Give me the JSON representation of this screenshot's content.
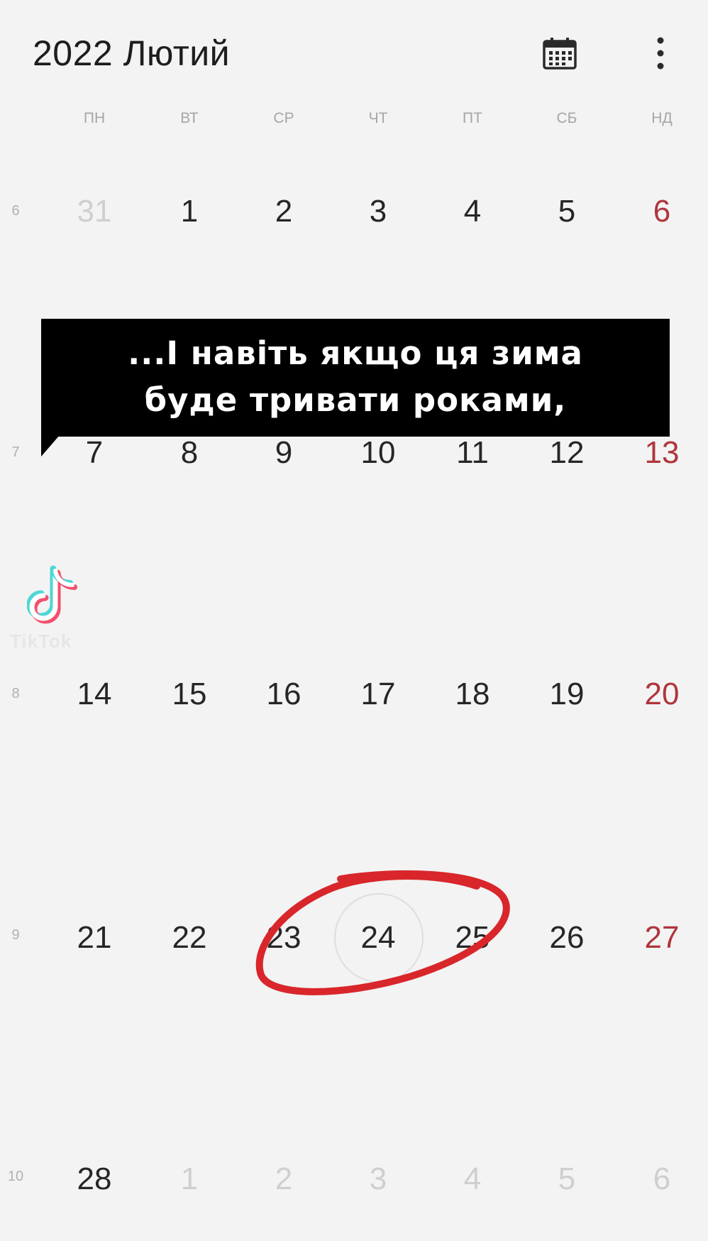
{
  "header": {
    "title": "2022 Лютий",
    "calendar_icon": "calendar-grid-icon",
    "more_icon": "more-vertical-icon"
  },
  "weekdays": [
    "ПН",
    "ВТ",
    "СР",
    "ЧТ",
    "ПТ",
    "СБ",
    "НД"
  ],
  "weeks": [
    {
      "num": "6",
      "days": [
        "31",
        "1",
        "2",
        "3",
        "4",
        "5",
        "6"
      ]
    },
    {
      "num": "7",
      "days": [
        "7",
        "8",
        "9",
        "10",
        "11",
        "12",
        "13"
      ]
    },
    {
      "num": "8",
      "days": [
        "14",
        "15",
        "16",
        "17",
        "18",
        "19",
        "20"
      ]
    },
    {
      "num": "9",
      "days": [
        "21",
        "22",
        "23",
        "24",
        "25",
        "26",
        "27"
      ]
    },
    {
      "num": "10",
      "days": [
        "28",
        "1",
        "2",
        "3",
        "4",
        "5",
        "6"
      ]
    }
  ],
  "today": "24",
  "caption": {
    "line1": "...І навіть якщо ця зима",
    "line2": "буде тривати роками,"
  },
  "watermark": {
    "text": "TikTok",
    "icon": "tiktok-logo-icon"
  },
  "colors": {
    "background": "#f3f3f3",
    "sunday": "#b0353c",
    "muted": "#cfcfcf",
    "scribble": "#d8262b",
    "caption_bg": "#000000"
  }
}
